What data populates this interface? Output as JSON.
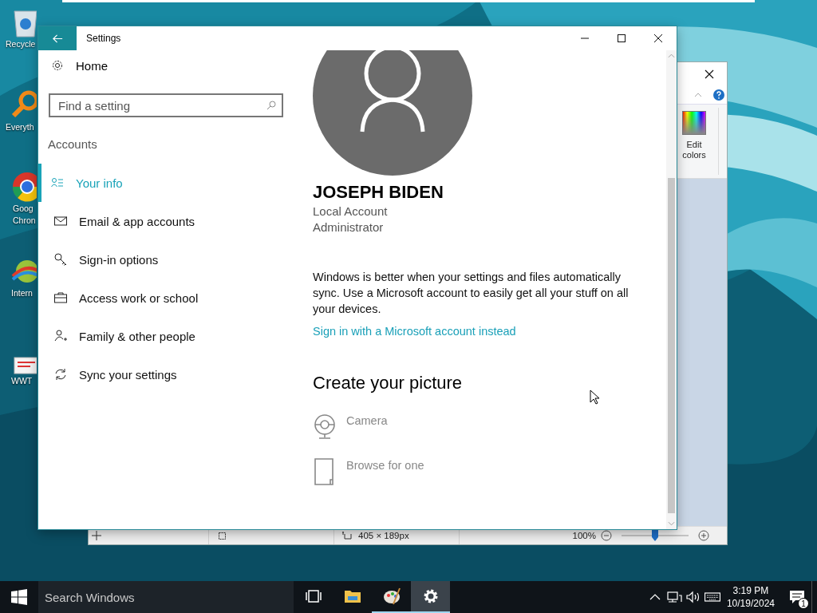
{
  "desktop": {
    "icons": [
      {
        "kind": "recycle-bin",
        "label": "Recycle"
      },
      {
        "kind": "magnifier",
        "label": "Everyth"
      },
      {
        "kind": "browser",
        "label": "Goog Chron"
      },
      {
        "kind": "download",
        "label": "Intern"
      },
      {
        "kind": "document",
        "label": "WWT"
      }
    ]
  },
  "paint_window": {
    "ribbon_button": {
      "label": "Edit colors"
    },
    "status_bar": {
      "size": "405 × 189px",
      "zoom": "100%",
      "zoom_slider": {
        "level": 0.5
      }
    }
  },
  "settings": {
    "title": "Settings",
    "home": "Home",
    "search": {
      "placeholder": "Find a setting"
    },
    "section": "Accounts",
    "nav": [
      {
        "kind": "person-list",
        "label": "Your info",
        "selected": true
      },
      {
        "kind": "mail",
        "label": "Email & app accounts",
        "selected": false
      },
      {
        "kind": "key",
        "label": "Sign-in options",
        "selected": false
      },
      {
        "kind": "briefcase",
        "label": "Access work or school",
        "selected": false
      },
      {
        "kind": "person-add",
        "label": "Family & other people",
        "selected": false
      },
      {
        "kind": "sync",
        "label": "Sync your settings",
        "selected": false
      }
    ],
    "account": {
      "name": "JOSEPH BIDEN",
      "type": "Local Account",
      "role": "Administrator"
    },
    "promo": {
      "text": "Windows is better when your settings and files automatically sync. Use a Microsoft account to easily get all your stuff on all your devices.",
      "link": "Sign in with a Microsoft account instead"
    },
    "picture": {
      "heading": "Create your picture",
      "options": [
        {
          "kind": "camera",
          "label": "Camera",
          "disabled": true
        },
        {
          "kind": "browse",
          "label": "Browse for one",
          "disabled": true
        }
      ]
    }
  },
  "taskbar": {
    "search": {
      "placeholder": "Search Windows"
    },
    "apps": [
      {
        "kind": "task-view",
        "selected": false,
        "running": false
      },
      {
        "kind": "folder",
        "selected": false,
        "running": false
      },
      {
        "kind": "paint",
        "selected": false,
        "running": true
      },
      {
        "kind": "gear",
        "selected": true,
        "running": true
      }
    ],
    "tray": [
      {
        "kind": "caret"
      },
      {
        "kind": "network"
      },
      {
        "kind": "volume"
      },
      {
        "kind": "keyboard"
      }
    ],
    "time": "3:19 PM",
    "date": "10/19/2024",
    "notifications": {
      "count": "1"
    }
  }
}
